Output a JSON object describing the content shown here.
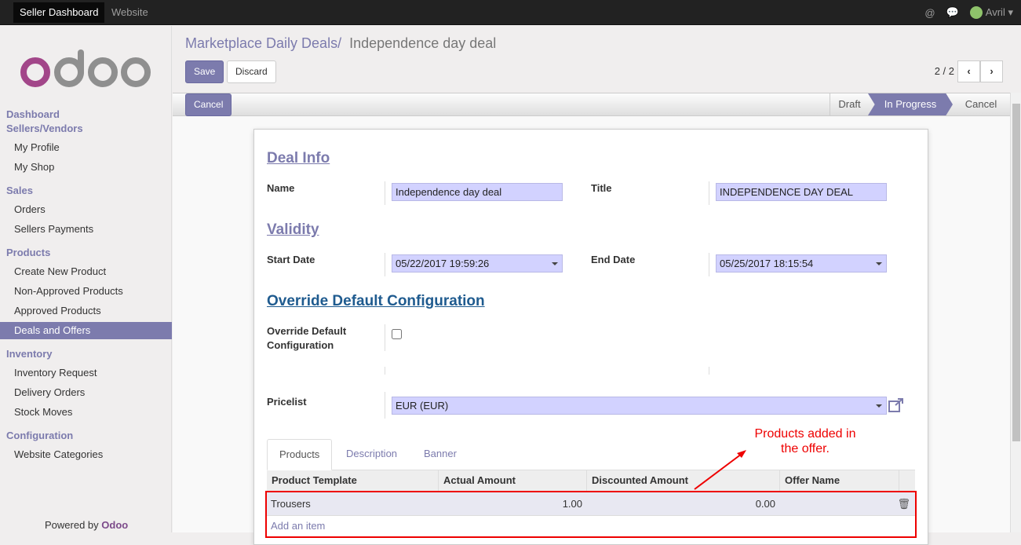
{
  "topbar": {
    "tabs": [
      "Seller Dashboard",
      "Website"
    ],
    "user": "Avril"
  },
  "sidebar": {
    "sections": [
      {
        "title": "Dashboard"
      },
      {
        "title": "Sellers/Vendors",
        "items": [
          "My Profile",
          "My Shop"
        ]
      },
      {
        "title": "Sales",
        "items": [
          "Orders",
          "Sellers Payments"
        ]
      },
      {
        "title": "Products",
        "items": [
          "Create New Product",
          "Non-Approved Products",
          "Approved Products",
          "Deals and Offers"
        ]
      },
      {
        "title": "Inventory",
        "items": [
          "Inventory Request",
          "Delivery Orders",
          "Stock Moves"
        ]
      },
      {
        "title": "Configuration",
        "items": [
          "Website Categories"
        ]
      }
    ],
    "active": "Deals and Offers",
    "powered_prefix": "Powered by",
    "powered_brand": "Odoo"
  },
  "breadcrumb": {
    "parent": "Marketplace Daily Deals",
    "sep": "/",
    "current": "Independence day deal"
  },
  "toolbar": {
    "save": "Save",
    "discard": "Discard",
    "pager": "2 / 2",
    "cancel": "Cancel"
  },
  "status": {
    "stages": [
      "Draft",
      "In Progress",
      "Cancel"
    ],
    "active": "In Progress"
  },
  "form": {
    "deal_info": "Deal Info",
    "name_label": "Name",
    "name": "Independence day deal",
    "title_label": "Title",
    "title": "INDEPENDENCE DAY DEAL",
    "validity": "Validity",
    "start_label": "Start Date",
    "start": "05/22/2017 19:59:26",
    "end_label": "End Date",
    "end": "05/25/2017 18:15:54",
    "override": "Override Default Configuration",
    "override_label1": "Override Default",
    "override_label2": "Configuration",
    "override_checked": false,
    "pricelist_label": "Pricelist",
    "pricelist": "EUR (EUR)"
  },
  "tabs": [
    "Products",
    "Description",
    "Banner"
  ],
  "table": {
    "columns": [
      "Product Template",
      "Actual Amount",
      "Discounted Amount",
      "Offer Name"
    ],
    "rows": [
      {
        "product": "Trousers",
        "actual": "1.00",
        "discounted": "0.00",
        "offer": ""
      }
    ],
    "add": "Add an item"
  },
  "annotation": {
    "line1": "Products added in",
    "line2": "the offer."
  },
  "colors": {
    "accent": "#7c7bad",
    "highlight": "#ee0000",
    "input": "#d2d2ff"
  }
}
